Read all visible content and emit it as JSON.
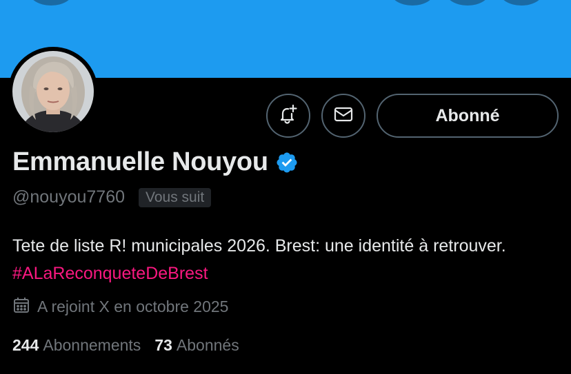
{
  "profile": {
    "display_name": "Emmanuelle Nouyou",
    "handle": "@nouyou7760",
    "follows_you_badge": "Vous suit",
    "bio_text": "Tete de liste R! municipales 2026. Brest: une identité à retrouver. ",
    "bio_hashtag": "#ALaReconqueteDeBrest",
    "joined": "A rejoint X en octobre 2025",
    "verified": true
  },
  "actions": {
    "follow_state_label": "Abonné",
    "notification_icon": "bell-plus-icon",
    "message_icon": "envelope-icon"
  },
  "stats": {
    "following_count": "244",
    "following_label": "Abonnements",
    "followers_count": "73",
    "followers_label": "Abonnés"
  },
  "colors": {
    "banner": "#1d9bf0",
    "background": "#000000",
    "text_primary": "#e7e9ea",
    "text_secondary": "#71767b",
    "hashtag": "#f91880",
    "verified_badge": "#1d9bf0",
    "button_border": "#536471"
  }
}
